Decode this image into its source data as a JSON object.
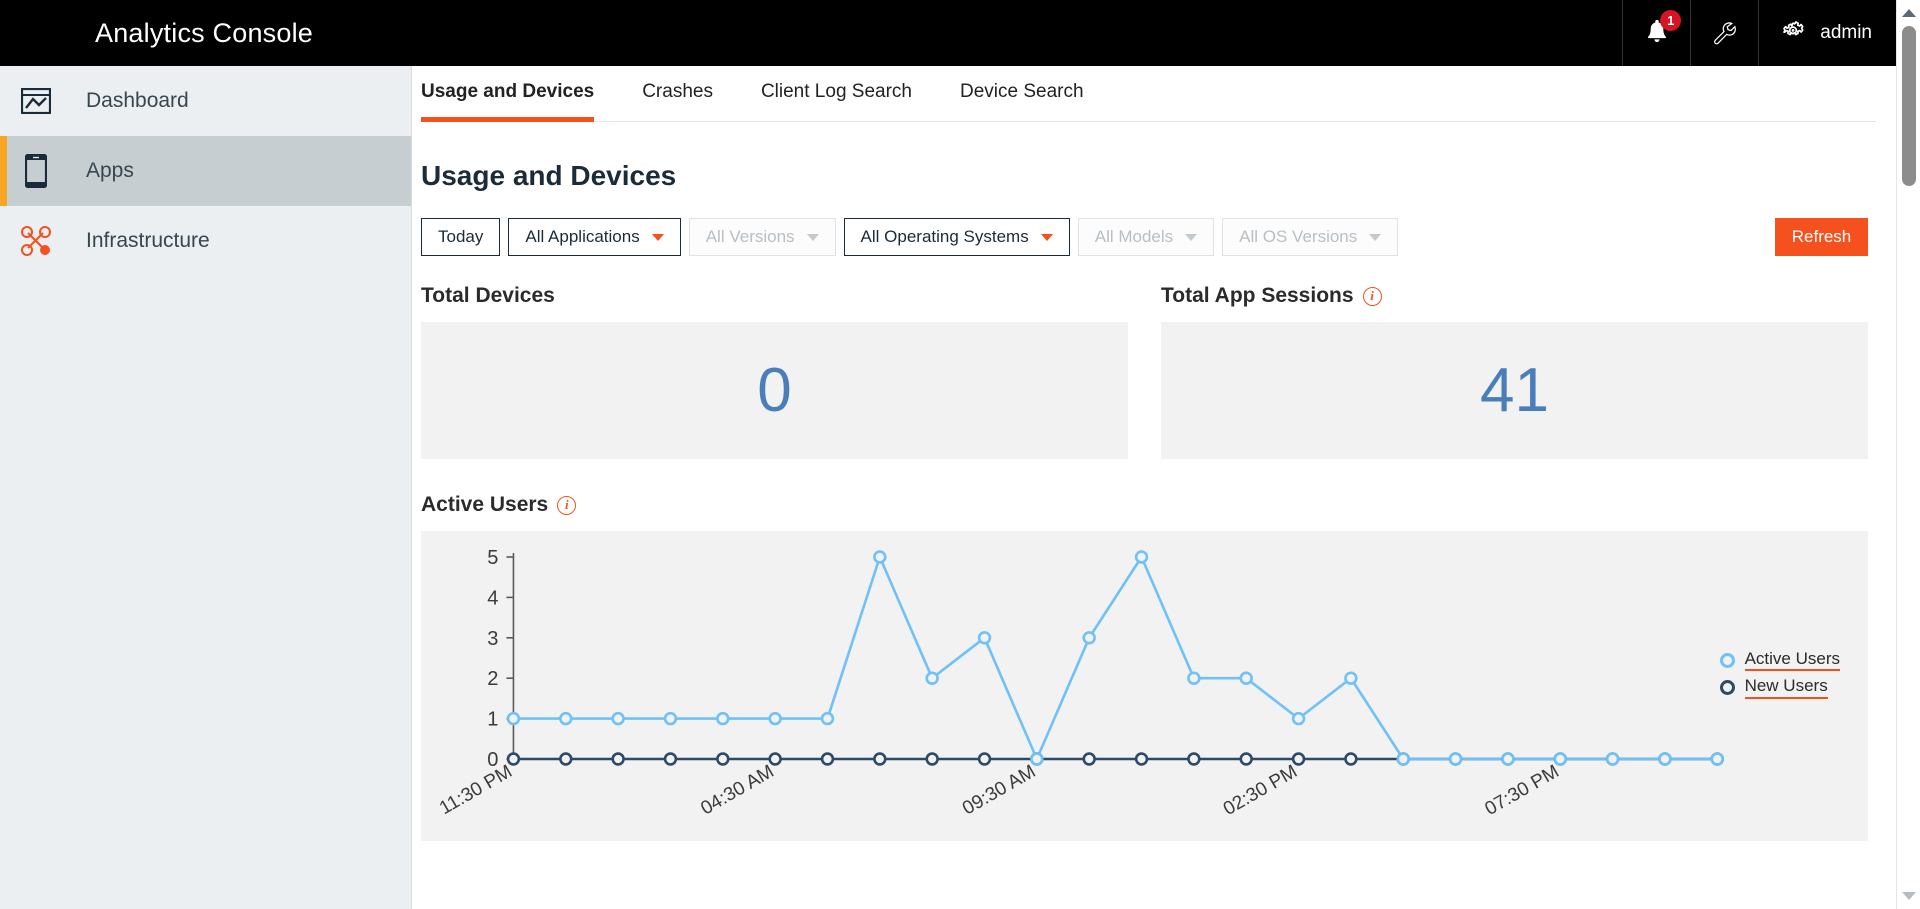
{
  "header": {
    "title": "Analytics Console",
    "notification_badge": "1",
    "notification_icon": "bell-icon",
    "tools_icon": "wrench-icon",
    "settings_icon": "gear-icon",
    "user_label": "admin"
  },
  "sidebar": {
    "items": [
      {
        "label": "Dashboard",
        "icon": "chart-box-icon",
        "active": false
      },
      {
        "label": "Apps",
        "icon": "mobile-phone-icon",
        "active": true
      },
      {
        "label": "Infrastructure",
        "icon": "network-nodes-icon",
        "active": false
      }
    ]
  },
  "tabs": [
    {
      "label": "Usage and Devices",
      "active": true
    },
    {
      "label": "Crashes",
      "active": false
    },
    {
      "label": "Client Log Search",
      "active": false
    },
    {
      "label": "Device Search",
      "active": false
    }
  ],
  "main": {
    "page_title": "Usage and Devices",
    "filters": [
      {
        "label": "Today",
        "has_caret": false,
        "disabled": false
      },
      {
        "label": "All Applications",
        "has_caret": true,
        "disabled": false
      },
      {
        "label": "All Versions",
        "has_caret": true,
        "disabled": true
      },
      {
        "label": "All Operating Systems",
        "has_caret": true,
        "disabled": false
      },
      {
        "label": "All Models",
        "has_caret": true,
        "disabled": true
      },
      {
        "label": "All OS Versions",
        "has_caret": true,
        "disabled": true
      }
    ],
    "refresh_label": "Refresh",
    "kpis": [
      {
        "title": "Total Devices",
        "value": "0",
        "has_info": false
      },
      {
        "title": "Total App Sessions",
        "value": "41",
        "has_info": true
      }
    ],
    "chart_section_title": "Active Users",
    "chart_section_has_info": true
  },
  "colors": {
    "accent_orange": "#f4511e",
    "sidebar_active_bar": "#f5a623",
    "kpi_value_blue": "#4a7ebb",
    "active_users_line": "#6fc1f7",
    "new_users_line": "#2d4a66",
    "badge_red": "#d81324",
    "header_black": "#000000"
  },
  "chart_data": {
    "type": "line",
    "title": "Active Users",
    "xlabel": "",
    "ylabel": "",
    "ylim": [
      0,
      5
    ],
    "yticks": [
      0,
      1,
      2,
      3,
      4,
      5
    ],
    "grid": false,
    "legend_position": "right",
    "x_tick_labels": [
      "11:30 PM",
      "04:30 AM",
      "09:30 AM",
      "02:30 PM",
      "07:30 PM"
    ],
    "x_tick_indices": [
      0,
      5,
      10,
      15,
      20
    ],
    "x": [
      0,
      1,
      2,
      3,
      4,
      5,
      6,
      7,
      8,
      9,
      10,
      11,
      12,
      13,
      14,
      15,
      16,
      17,
      18,
      19,
      20,
      21,
      22,
      23
    ],
    "series": [
      {
        "name": "Active Users",
        "color": "#6fc1f7",
        "values": [
          1,
          1,
          1,
          1,
          1,
          1,
          1,
          5,
          2,
          3,
          0,
          3,
          5,
          2,
          2,
          1,
          2,
          0,
          0,
          0,
          0,
          0,
          0,
          0
        ]
      },
      {
        "name": "New Users",
        "color": "#2d4a66",
        "values": [
          0,
          0,
          0,
          0,
          0,
          0,
          0,
          0,
          0,
          0,
          0,
          0,
          0,
          0,
          0,
          0,
          0,
          0,
          0,
          0,
          0,
          0,
          0,
          0
        ]
      }
    ]
  },
  "scrollbar": {
    "up_arrow": "scroll-up-arrow-icon",
    "down_arrow": "scroll-down-arrow-icon"
  }
}
